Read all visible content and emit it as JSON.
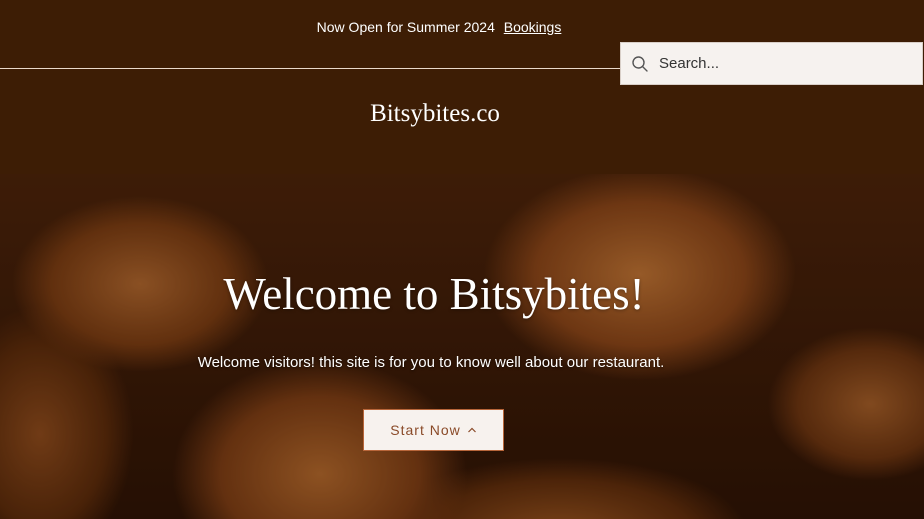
{
  "announcement": {
    "text": "Now Open for Summer 2024",
    "link_label": "Bookings"
  },
  "search": {
    "placeholder": "Search...",
    "icon": "search-icon"
  },
  "site": {
    "logo_text": "Bitsybites.co"
  },
  "hero": {
    "heading": "Welcome to Bitsybites!",
    "subheading": "Welcome visitors! this site is for you to know well about our restaurant.",
    "cta_label": "Start Now",
    "cta_icon": "chevron-up-icon"
  },
  "colors": {
    "header_background": "#3d1d05",
    "search_background": "#f6f2ef",
    "cta_text": "#8a4a28",
    "cta_border": "#b8663a"
  }
}
